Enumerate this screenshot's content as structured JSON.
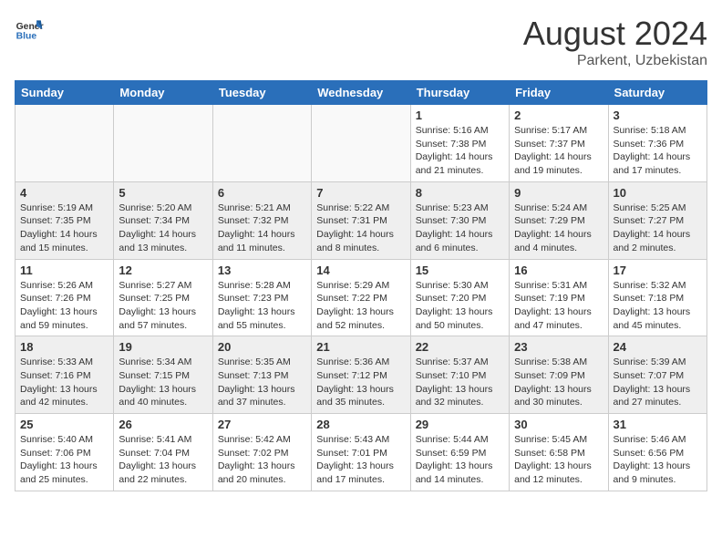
{
  "header": {
    "logo_general": "General",
    "logo_blue": "Blue",
    "month_year": "August 2024",
    "location": "Parkent, Uzbekistan"
  },
  "weekdays": [
    "Sunday",
    "Monday",
    "Tuesday",
    "Wednesday",
    "Thursday",
    "Friday",
    "Saturday"
  ],
  "weeks": [
    [
      {
        "day": "",
        "info": ""
      },
      {
        "day": "",
        "info": ""
      },
      {
        "day": "",
        "info": ""
      },
      {
        "day": "",
        "info": ""
      },
      {
        "day": "1",
        "info": "Sunrise: 5:16 AM\nSunset: 7:38 PM\nDaylight: 14 hours and 21 minutes."
      },
      {
        "day": "2",
        "info": "Sunrise: 5:17 AM\nSunset: 7:37 PM\nDaylight: 14 hours and 19 minutes."
      },
      {
        "day": "3",
        "info": "Sunrise: 5:18 AM\nSunset: 7:36 PM\nDaylight: 14 hours and 17 minutes."
      }
    ],
    [
      {
        "day": "4",
        "info": "Sunrise: 5:19 AM\nSunset: 7:35 PM\nDaylight: 14 hours and 15 minutes."
      },
      {
        "day": "5",
        "info": "Sunrise: 5:20 AM\nSunset: 7:34 PM\nDaylight: 14 hours and 13 minutes."
      },
      {
        "day": "6",
        "info": "Sunrise: 5:21 AM\nSunset: 7:32 PM\nDaylight: 14 hours and 11 minutes."
      },
      {
        "day": "7",
        "info": "Sunrise: 5:22 AM\nSunset: 7:31 PM\nDaylight: 14 hours and 8 minutes."
      },
      {
        "day": "8",
        "info": "Sunrise: 5:23 AM\nSunset: 7:30 PM\nDaylight: 14 hours and 6 minutes."
      },
      {
        "day": "9",
        "info": "Sunrise: 5:24 AM\nSunset: 7:29 PM\nDaylight: 14 hours and 4 minutes."
      },
      {
        "day": "10",
        "info": "Sunrise: 5:25 AM\nSunset: 7:27 PM\nDaylight: 14 hours and 2 minutes."
      }
    ],
    [
      {
        "day": "11",
        "info": "Sunrise: 5:26 AM\nSunset: 7:26 PM\nDaylight: 13 hours and 59 minutes."
      },
      {
        "day": "12",
        "info": "Sunrise: 5:27 AM\nSunset: 7:25 PM\nDaylight: 13 hours and 57 minutes."
      },
      {
        "day": "13",
        "info": "Sunrise: 5:28 AM\nSunset: 7:23 PM\nDaylight: 13 hours and 55 minutes."
      },
      {
        "day": "14",
        "info": "Sunrise: 5:29 AM\nSunset: 7:22 PM\nDaylight: 13 hours and 52 minutes."
      },
      {
        "day": "15",
        "info": "Sunrise: 5:30 AM\nSunset: 7:20 PM\nDaylight: 13 hours and 50 minutes."
      },
      {
        "day": "16",
        "info": "Sunrise: 5:31 AM\nSunset: 7:19 PM\nDaylight: 13 hours and 47 minutes."
      },
      {
        "day": "17",
        "info": "Sunrise: 5:32 AM\nSunset: 7:18 PM\nDaylight: 13 hours and 45 minutes."
      }
    ],
    [
      {
        "day": "18",
        "info": "Sunrise: 5:33 AM\nSunset: 7:16 PM\nDaylight: 13 hours and 42 minutes."
      },
      {
        "day": "19",
        "info": "Sunrise: 5:34 AM\nSunset: 7:15 PM\nDaylight: 13 hours and 40 minutes."
      },
      {
        "day": "20",
        "info": "Sunrise: 5:35 AM\nSunset: 7:13 PM\nDaylight: 13 hours and 37 minutes."
      },
      {
        "day": "21",
        "info": "Sunrise: 5:36 AM\nSunset: 7:12 PM\nDaylight: 13 hours and 35 minutes."
      },
      {
        "day": "22",
        "info": "Sunrise: 5:37 AM\nSunset: 7:10 PM\nDaylight: 13 hours and 32 minutes."
      },
      {
        "day": "23",
        "info": "Sunrise: 5:38 AM\nSunset: 7:09 PM\nDaylight: 13 hours and 30 minutes."
      },
      {
        "day": "24",
        "info": "Sunrise: 5:39 AM\nSunset: 7:07 PM\nDaylight: 13 hours and 27 minutes."
      }
    ],
    [
      {
        "day": "25",
        "info": "Sunrise: 5:40 AM\nSunset: 7:06 PM\nDaylight: 13 hours and 25 minutes."
      },
      {
        "day": "26",
        "info": "Sunrise: 5:41 AM\nSunset: 7:04 PM\nDaylight: 13 hours and 22 minutes."
      },
      {
        "day": "27",
        "info": "Sunrise: 5:42 AM\nSunset: 7:02 PM\nDaylight: 13 hours and 20 minutes."
      },
      {
        "day": "28",
        "info": "Sunrise: 5:43 AM\nSunset: 7:01 PM\nDaylight: 13 hours and 17 minutes."
      },
      {
        "day": "29",
        "info": "Sunrise: 5:44 AM\nSunset: 6:59 PM\nDaylight: 13 hours and 14 minutes."
      },
      {
        "day": "30",
        "info": "Sunrise: 5:45 AM\nSunset: 6:58 PM\nDaylight: 13 hours and 12 minutes."
      },
      {
        "day": "31",
        "info": "Sunrise: 5:46 AM\nSunset: 6:56 PM\nDaylight: 13 hours and 9 minutes."
      }
    ]
  ]
}
